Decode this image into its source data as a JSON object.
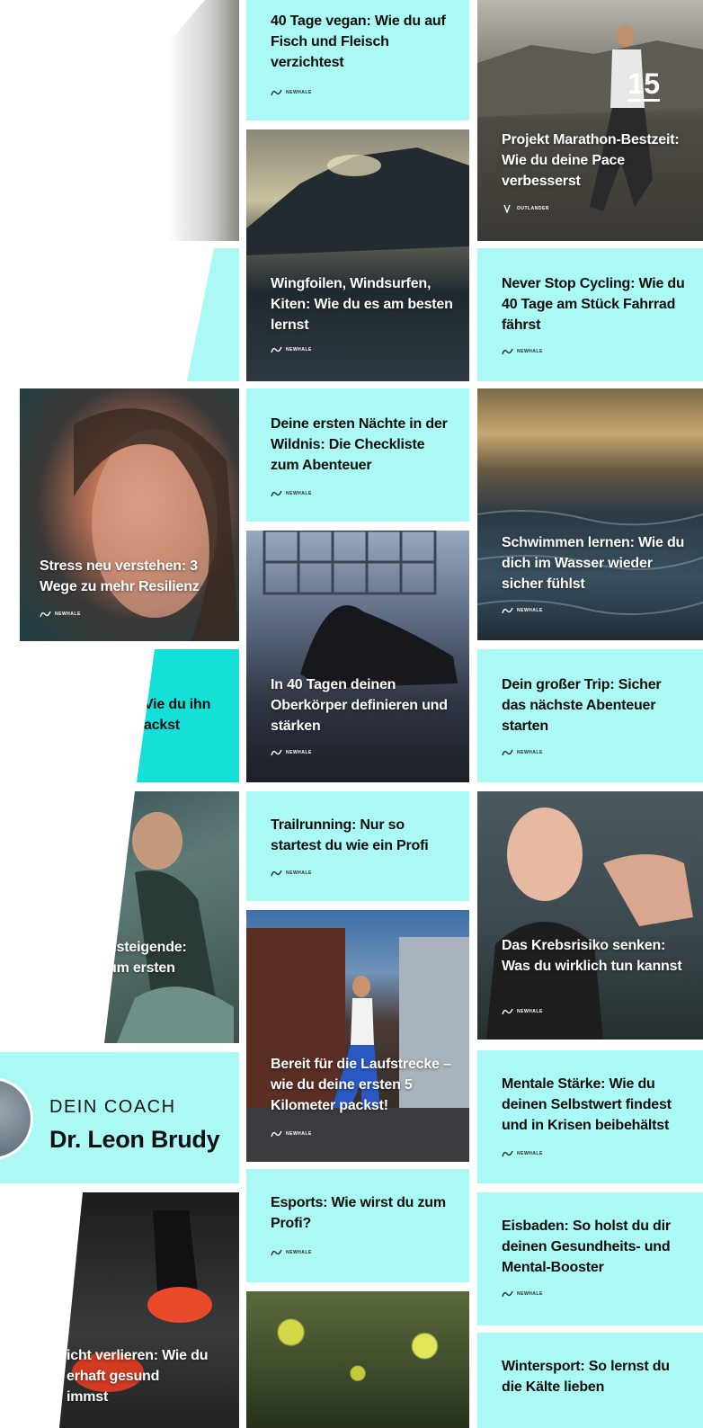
{
  "brand_label": "NEWHALE",
  "brand_label_outdoor": "OUTLANDER",
  "colors": {
    "tile_cyan": "#aaf9f5",
    "accent_teal": "#15e0d8"
  },
  "left_column": {
    "partial_title_1": ":",
    "stress_title": "Stress neu verstehen: 3 Wege zu mehr Resilienz",
    "partial_title_2a": "Vie du ihn",
    "partial_title_2b": "ackst",
    "partial_title_3a": "nsteigende:",
    "partial_title_3b": "um ersten",
    "coach": {
      "label": "DEIN COACH",
      "name": "Dr. Leon Brudy"
    },
    "partial_title_4a": "icht verlieren: Wie du",
    "partial_title_4b": "erhaft gesund",
    "partial_title_4c": "immst"
  },
  "middle_column": [
    {
      "title": "40 Tage vegan: Wie du auf Fisch und Fleisch verzichtest"
    },
    {
      "title": "Wingfoilen, Windsurfen, Kiten: Wie du es am besten lernst"
    },
    {
      "title": "Deine ersten Nächte in der Wildnis: Die Checkliste zum Abenteuer"
    },
    {
      "title": "In 40 Tagen deinen Oberkörper definieren und stärken"
    },
    {
      "title": "Trailrunning: Nur so startest du wie ein Profi"
    },
    {
      "title": "Bereit für die Laufstrecke – wie du deine ersten 5 Kilometer packst!"
    },
    {
      "title": "Esports: Wie wirst du zum Profi?"
    }
  ],
  "right_column": [
    {
      "title": "Projekt Marathon-Bestzeit: Wie du deine Pace verbesserst",
      "number": "15"
    },
    {
      "title": "Never Stop Cycling: Wie du 40 Tage am Stück Fahrrad fährst"
    },
    {
      "title": "Schwimmen lernen: Wie du dich im Wasser wieder sicher fühlst"
    },
    {
      "title": "Dein großer Trip: Sicher das nächste Abenteuer starten"
    },
    {
      "title": "Das Krebsrisiko senken: Was du wirklich tun kannst"
    },
    {
      "title": "Mentale Stärke: Wie du deinen Selbstwert findest und in Krisen beibehältst"
    },
    {
      "title": "Eisbaden: So holst du dir deinen Gesundheits- und Mental-Booster"
    },
    {
      "title": "Wintersport: So lernst du die Kälte lieben"
    }
  ]
}
